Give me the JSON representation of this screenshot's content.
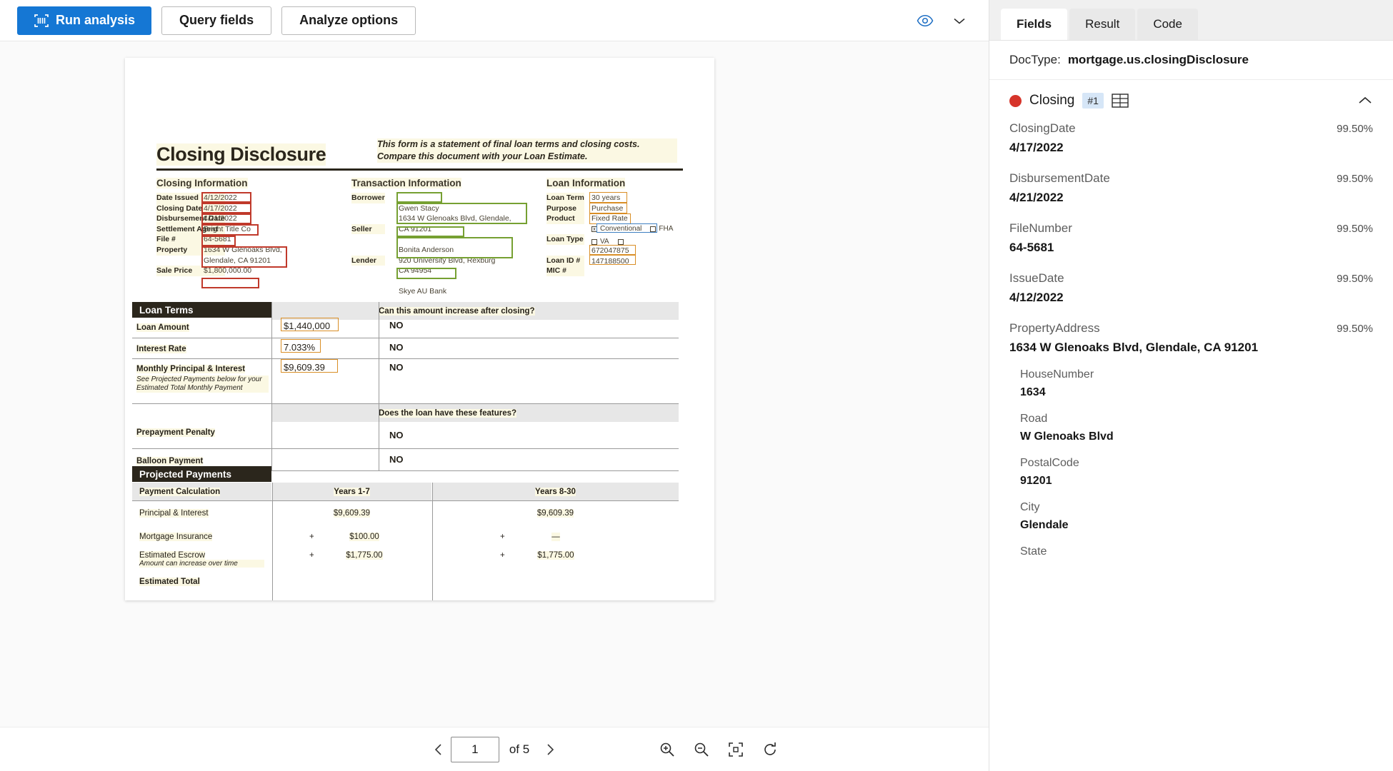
{
  "toolbar": {
    "run_analysis": "Run analysis",
    "query_fields": "Query fields",
    "analyze_options": "Analyze options",
    "eye_icon": "eye-icon",
    "chevron_down_icon": "chevron-down-icon",
    "scan_icon": "scan-icon"
  },
  "pager": {
    "prev_icon": "chevron-left-icon",
    "next_icon": "chevron-right-icon",
    "page_value": "1",
    "page_of": "of 5",
    "zoom_in_icon": "zoom-in-icon",
    "zoom_out_icon": "zoom-out-icon",
    "fit_page_icon": "fit-page-icon",
    "rotate_icon": "rotate-icon"
  },
  "document": {
    "title": "Closing Disclosure",
    "subtitle": "This form is a statement of final loan terms and closing costs. Compare this document with your Loan Estimate.",
    "closing_information": {
      "heading": "Closing Information",
      "rows": [
        {
          "label": "Date Issued",
          "value": "4/12/2022"
        },
        {
          "label": "Closing Date",
          "value": "4/17/2022"
        },
        {
          "label": "Disbursement Date",
          "value": "4/21/2022"
        },
        {
          "label": "Settlement Agent",
          "value": "Bright  Title Co"
        },
        {
          "label": "File #",
          "value": "64-5681"
        },
        {
          "label": "Property",
          "value": "1634 W Glenoaks Blvd, Glendale, CA 91201"
        },
        {
          "label": "Sale Price",
          "value": "$1,800,000.00"
        }
      ]
    },
    "transaction_information": {
      "heading": "Transaction Information",
      "rows": [
        {
          "label": "Borrower",
          "value": "Gwen Stacy\n1634 W Glenoaks Blvd, Glendale,\nCA 91201"
        },
        {
          "label": "Seller",
          "value": "Bonita Anderson\n920 University Blvd, Rexburg\nCA 94954"
        },
        {
          "label": "Lender",
          "value": "Skye AU Bank"
        }
      ]
    },
    "loan_information": {
      "heading": "Loan Information",
      "rows": [
        {
          "label": "Loan Term",
          "value": "30 years"
        },
        {
          "label": "Purpose",
          "value": "Purchase"
        },
        {
          "label": "Product",
          "value": "Fixed Rate"
        },
        {
          "label": "Loan Type",
          "value": "Conventional   FHA   VA"
        },
        {
          "label": "Loan ID #",
          "value": "672047875"
        },
        {
          "label": "MIC #",
          "value": "147188500"
        }
      ],
      "loan_type_options": [
        "Conventional",
        "FHA",
        "VA",
        ""
      ],
      "loan_type_checked": "Conventional"
    },
    "loan_terms": {
      "section_title": "Loan Terms",
      "question_increase": "Can this amount increase after closing?",
      "question_features": "Does the loan have these features?",
      "rows": [
        {
          "label": "Loan Amount",
          "value": "$1,440,000",
          "answer": "NO",
          "note": ""
        },
        {
          "label": "Interest Rate",
          "value": "7.033%",
          "answer": "NO",
          "note": ""
        },
        {
          "label": "Monthly Principal & Interest",
          "value": "$9,609.39",
          "answer": "NO",
          "note": "See Projected Payments below for your Estimated Total Monthly Payment"
        },
        {
          "label": "Prepayment Penalty",
          "value": "",
          "answer": "NO",
          "note": ""
        },
        {
          "label": "Balloon Payment",
          "value": "",
          "answer": "NO",
          "note": ""
        }
      ]
    },
    "projected_payments": {
      "section_title": "Projected Payments",
      "columns": [
        "Payment Calculation",
        "Years 1-7",
        "Years 8-30"
      ],
      "rows": [
        {
          "label": "Principal & Interest",
          "sublabel": "",
          "c1_sign": "",
          "c1": "$9,609.39",
          "c2_sign": "",
          "c2": "$9,609.39"
        },
        {
          "label": "Mortgage Insurance",
          "sublabel": "",
          "c1_sign": "+",
          "c1": "$100.00",
          "c2_sign": "+",
          "c2": "—"
        },
        {
          "label": "Estimated Escrow",
          "sublabel": "Amount can increase over time",
          "c1_sign": "+",
          "c1": "$1,775.00",
          "c2_sign": "+",
          "c2": "$1,775.00"
        },
        {
          "label": "Estimated Total",
          "sublabel": "",
          "c1_sign": "",
          "c1": "",
          "c2_sign": "",
          "c2": ""
        }
      ]
    }
  },
  "right_panel": {
    "tabs": [
      {
        "label": "Fields",
        "active": true
      },
      {
        "label": "Result",
        "active": false
      },
      {
        "label": "Code",
        "active": false
      }
    ],
    "doctype_label": "DocType:",
    "doctype_value": "mortgage.us.closingDisclosure",
    "group": {
      "status_color": "#d6342a",
      "name": "Closing",
      "badge": "#1",
      "table_icon": "table-icon",
      "collapse_icon": "chevron-up-icon"
    },
    "fields": [
      {
        "name": "ClosingDate",
        "confidence": "99.50%",
        "value": "4/17/2022",
        "nested": false
      },
      {
        "name": "DisbursementDate",
        "confidence": "99.50%",
        "value": "4/21/2022",
        "nested": false
      },
      {
        "name": "FileNumber",
        "confidence": "99.50%",
        "value": "64-5681",
        "nested": false
      },
      {
        "name": "IssueDate",
        "confidence": "99.50%",
        "value": "4/12/2022",
        "nested": false
      },
      {
        "name": "PropertyAddress",
        "confidence": "99.50%",
        "value": "1634 W Glenoaks Blvd, Glendale, CA 91201",
        "nested": false
      },
      {
        "name": "HouseNumber",
        "confidence": "",
        "value": "1634",
        "nested": true
      },
      {
        "name": "Road",
        "confidence": "",
        "value": "W Glenoaks Blvd",
        "nested": true
      },
      {
        "name": "PostalCode",
        "confidence": "",
        "value": "91201",
        "nested": true
      },
      {
        "name": "City",
        "confidence": "",
        "value": "Glendale",
        "nested": true
      },
      {
        "name": "State",
        "confidence": "",
        "value": "",
        "nested": true
      }
    ]
  }
}
